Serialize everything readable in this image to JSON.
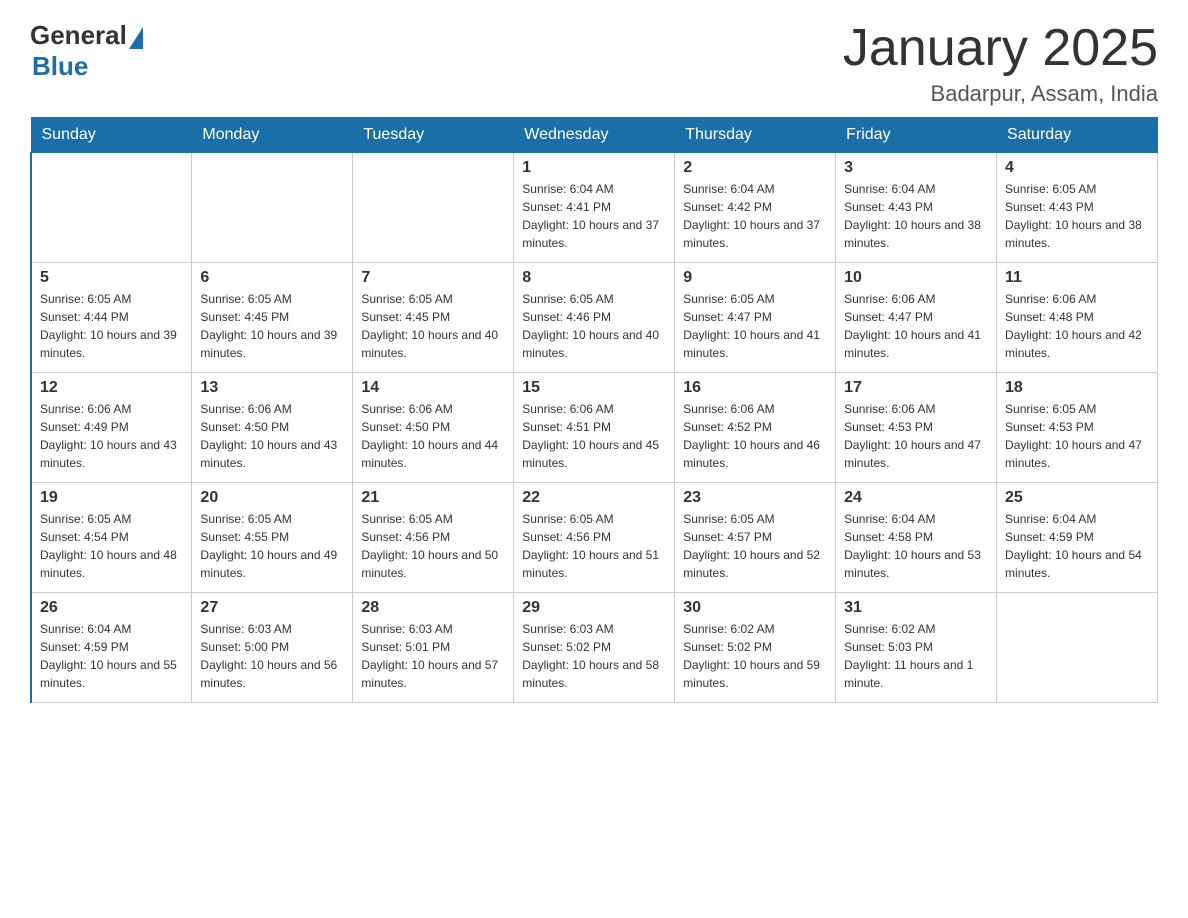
{
  "header": {
    "logo_general": "General",
    "logo_blue": "Blue",
    "month_title": "January 2025",
    "location": "Badarpur, Assam, India"
  },
  "days_of_week": [
    "Sunday",
    "Monday",
    "Tuesday",
    "Wednesday",
    "Thursday",
    "Friday",
    "Saturday"
  ],
  "weeks": [
    [
      {
        "day": "",
        "info": ""
      },
      {
        "day": "",
        "info": ""
      },
      {
        "day": "",
        "info": ""
      },
      {
        "day": "1",
        "info": "Sunrise: 6:04 AM\nSunset: 4:41 PM\nDaylight: 10 hours and 37 minutes."
      },
      {
        "day": "2",
        "info": "Sunrise: 6:04 AM\nSunset: 4:42 PM\nDaylight: 10 hours and 37 minutes."
      },
      {
        "day": "3",
        "info": "Sunrise: 6:04 AM\nSunset: 4:43 PM\nDaylight: 10 hours and 38 minutes."
      },
      {
        "day": "4",
        "info": "Sunrise: 6:05 AM\nSunset: 4:43 PM\nDaylight: 10 hours and 38 minutes."
      }
    ],
    [
      {
        "day": "5",
        "info": "Sunrise: 6:05 AM\nSunset: 4:44 PM\nDaylight: 10 hours and 39 minutes."
      },
      {
        "day": "6",
        "info": "Sunrise: 6:05 AM\nSunset: 4:45 PM\nDaylight: 10 hours and 39 minutes."
      },
      {
        "day": "7",
        "info": "Sunrise: 6:05 AM\nSunset: 4:45 PM\nDaylight: 10 hours and 40 minutes."
      },
      {
        "day": "8",
        "info": "Sunrise: 6:05 AM\nSunset: 4:46 PM\nDaylight: 10 hours and 40 minutes."
      },
      {
        "day": "9",
        "info": "Sunrise: 6:05 AM\nSunset: 4:47 PM\nDaylight: 10 hours and 41 minutes."
      },
      {
        "day": "10",
        "info": "Sunrise: 6:06 AM\nSunset: 4:47 PM\nDaylight: 10 hours and 41 minutes."
      },
      {
        "day": "11",
        "info": "Sunrise: 6:06 AM\nSunset: 4:48 PM\nDaylight: 10 hours and 42 minutes."
      }
    ],
    [
      {
        "day": "12",
        "info": "Sunrise: 6:06 AM\nSunset: 4:49 PM\nDaylight: 10 hours and 43 minutes."
      },
      {
        "day": "13",
        "info": "Sunrise: 6:06 AM\nSunset: 4:50 PM\nDaylight: 10 hours and 43 minutes."
      },
      {
        "day": "14",
        "info": "Sunrise: 6:06 AM\nSunset: 4:50 PM\nDaylight: 10 hours and 44 minutes."
      },
      {
        "day": "15",
        "info": "Sunrise: 6:06 AM\nSunset: 4:51 PM\nDaylight: 10 hours and 45 minutes."
      },
      {
        "day": "16",
        "info": "Sunrise: 6:06 AM\nSunset: 4:52 PM\nDaylight: 10 hours and 46 minutes."
      },
      {
        "day": "17",
        "info": "Sunrise: 6:06 AM\nSunset: 4:53 PM\nDaylight: 10 hours and 47 minutes."
      },
      {
        "day": "18",
        "info": "Sunrise: 6:05 AM\nSunset: 4:53 PM\nDaylight: 10 hours and 47 minutes."
      }
    ],
    [
      {
        "day": "19",
        "info": "Sunrise: 6:05 AM\nSunset: 4:54 PM\nDaylight: 10 hours and 48 minutes."
      },
      {
        "day": "20",
        "info": "Sunrise: 6:05 AM\nSunset: 4:55 PM\nDaylight: 10 hours and 49 minutes."
      },
      {
        "day": "21",
        "info": "Sunrise: 6:05 AM\nSunset: 4:56 PM\nDaylight: 10 hours and 50 minutes."
      },
      {
        "day": "22",
        "info": "Sunrise: 6:05 AM\nSunset: 4:56 PM\nDaylight: 10 hours and 51 minutes."
      },
      {
        "day": "23",
        "info": "Sunrise: 6:05 AM\nSunset: 4:57 PM\nDaylight: 10 hours and 52 minutes."
      },
      {
        "day": "24",
        "info": "Sunrise: 6:04 AM\nSunset: 4:58 PM\nDaylight: 10 hours and 53 minutes."
      },
      {
        "day": "25",
        "info": "Sunrise: 6:04 AM\nSunset: 4:59 PM\nDaylight: 10 hours and 54 minutes."
      }
    ],
    [
      {
        "day": "26",
        "info": "Sunrise: 6:04 AM\nSunset: 4:59 PM\nDaylight: 10 hours and 55 minutes."
      },
      {
        "day": "27",
        "info": "Sunrise: 6:03 AM\nSunset: 5:00 PM\nDaylight: 10 hours and 56 minutes."
      },
      {
        "day": "28",
        "info": "Sunrise: 6:03 AM\nSunset: 5:01 PM\nDaylight: 10 hours and 57 minutes."
      },
      {
        "day": "29",
        "info": "Sunrise: 6:03 AM\nSunset: 5:02 PM\nDaylight: 10 hours and 58 minutes."
      },
      {
        "day": "30",
        "info": "Sunrise: 6:02 AM\nSunset: 5:02 PM\nDaylight: 10 hours and 59 minutes."
      },
      {
        "day": "31",
        "info": "Sunrise: 6:02 AM\nSunset: 5:03 PM\nDaylight: 11 hours and 1 minute."
      },
      {
        "day": "",
        "info": ""
      }
    ]
  ]
}
